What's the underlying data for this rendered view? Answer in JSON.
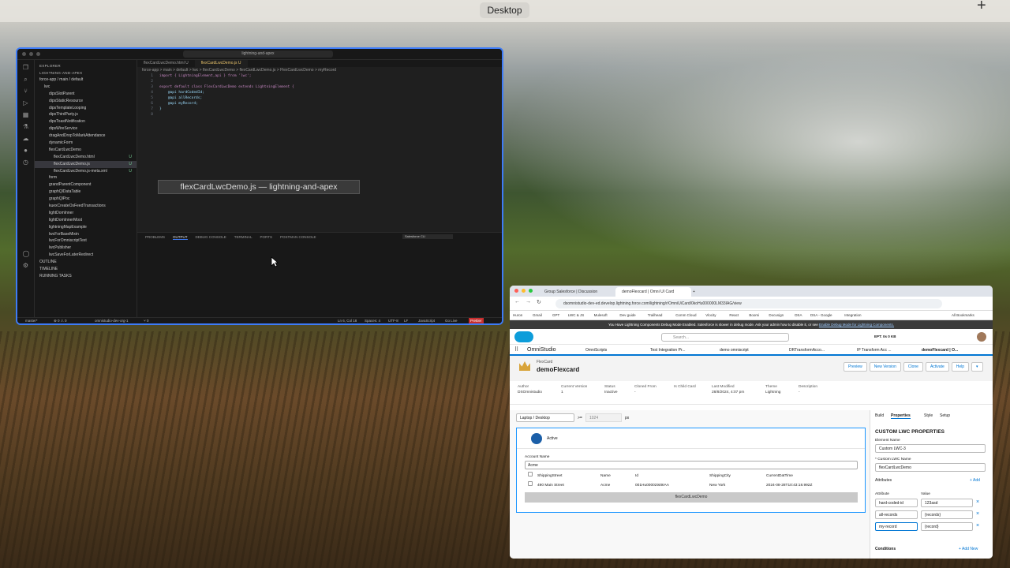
{
  "desktop": {
    "label": "Desktop"
  },
  "vscode": {
    "search": "lightning-and-apex",
    "explorer_title": "EXPLORER",
    "project": "LIGHTNING-AND-APEX",
    "tree": [
      {
        "label": "force-app / main / default",
        "indent": 0
      },
      {
        "label": "lwc",
        "indent": 1
      },
      {
        "label": "dipsSlotParent",
        "indent": 2
      },
      {
        "label": "dipsStaticResource",
        "indent": 2
      },
      {
        "label": "dipsTemplateLooping",
        "indent": 2
      },
      {
        "label": "dipsThirdParty.js",
        "indent": 2
      },
      {
        "label": "dipsToastNotification",
        "indent": 2
      },
      {
        "label": "dipsWireService",
        "indent": 2
      },
      {
        "label": "dragAndDropToMarkAttendance",
        "indent": 2
      },
      {
        "label": "dynamicForm",
        "indent": 2
      },
      {
        "label": "flexCardLwcDemo",
        "indent": 2
      },
      {
        "label": "flexCardLwcDemo.html",
        "indent": 3,
        "badge": "U"
      },
      {
        "label": "flexCardLwcDemo.js",
        "indent": 3,
        "badge": "U",
        "selected": true
      },
      {
        "label": "flexCardLwcDemo.js-meta.xml",
        "indent": 3,
        "badge": "U"
      },
      {
        "label": "form",
        "indent": 2
      },
      {
        "label": "grandParentComponent",
        "indent": 2
      },
      {
        "label": "graphQlDataTable",
        "indent": 2
      },
      {
        "label": "graphQlPoc",
        "indent": 2
      },
      {
        "label": "kuexCreateOsFeedTransactions",
        "indent": 2
      },
      {
        "label": "lightDomInner",
        "indent": 2
      },
      {
        "label": "lightDomInnerMost",
        "indent": 2
      },
      {
        "label": "lightningMapExample",
        "indent": 2
      },
      {
        "label": "lwcForBaseMixin",
        "indent": 2
      },
      {
        "label": "lwcForOmniscriptText",
        "indent": 2
      },
      {
        "label": "lwcPublisher",
        "indent": 2
      },
      {
        "label": "lwcSaveForLaterRedirect",
        "indent": 2
      },
      {
        "label": "OUTLINE",
        "indent": 0
      },
      {
        "label": "TIMELINE",
        "indent": 0
      },
      {
        "label": "RUNNING TASKS",
        "indent": 0
      }
    ],
    "tabs": [
      "flexCardLwcDemo.html U",
      "flexCardLwcDemo.js U"
    ],
    "breadcrumb": "force-app > main > default > lwc > flexCardLwcDemo > flexCardLwcDemo.js > FlexCardLwcDemo > myRecord",
    "code": [
      {
        "n": "1",
        "t": "import { LightningElement,api } from 'lwc';"
      },
      {
        "n": "2",
        "t": ""
      },
      {
        "n": "3",
        "t": "export default class FlexCardLwcDemo extends LightningElement {"
      },
      {
        "n": "4",
        "t": "    @api hardCodedId;"
      },
      {
        "n": "5",
        "t": "    @api allRecords;"
      },
      {
        "n": "6",
        "t": "    @api myRecord;"
      },
      {
        "n": "7",
        "t": "}"
      },
      {
        "n": "8",
        "t": ""
      }
    ],
    "tooltip": "flexCardLwcDemo.js — lightning-and-apex",
    "panel_tabs": [
      "PROBLEMS",
      "OUTPUT",
      "DEBUG CONSOLE",
      "TERMINAL",
      "PORTS",
      "POSTMAN CONSOLE"
    ],
    "panel_select": "Salesforce CLI",
    "status": {
      "branch": "master*",
      "sync": "⊗ 0 ⚠ 0",
      "org": "omnistudio-dev-org-1",
      "ports": "⑂ 0",
      "pos": "Ln 6, Col 18",
      "spaces": "Spaces: 4",
      "enc": "UTF-8",
      "eol": "LF",
      "lang": "JavaScript",
      "live": "Go Live",
      "prettier": "Prettier"
    }
  },
  "browser": {
    "tabs": [
      "Group Salesforce | Discussion",
      "demoFlexcard | Omni UI Card"
    ],
    "url": "dsomnistudio-dev-ed.develop.lightning.force.com/lightning/r/OmniUiCard/0koHu000000LM33IAG/view",
    "bookmarks": [
      "Huron",
      "Gmail",
      "GPT",
      "LWC & JS",
      "Mulesoft",
      "Dev guide",
      "Trailhead",
      "Comm Cloud",
      "Vlocity",
      "React",
      "Boomi",
      "Docusign",
      "DSA",
      "DSA - Google",
      "Integration",
      "All Bookmarks"
    ],
    "warning": "You Have Lightning Components Debug Mode Enabled. Salesforce is slower in debug mode. Ask your admin how to disable it, or see",
    "warning_link": "Enable Debug Mode for Lightning Components.",
    "search_placeholder": "Search...",
    "ept": "EPT: 0s 0 KB",
    "app": "OmniStudio",
    "nav": [
      "OmniScripts",
      "Test Integration Pr...",
      "demo omniscript",
      "DRTransformAcco...",
      "IP Transform Acc ...",
      "demoFlexcard | O..."
    ],
    "record_type": "FlexCard",
    "record_name": "demoFlexcard",
    "buttons": [
      "Preview",
      "New Version",
      "Clone",
      "Activate",
      "Help"
    ],
    "meta": [
      {
        "l": "Author",
        "v": "DSOmnistudio"
      },
      {
        "l": "Current Version",
        "v": "1"
      },
      {
        "l": "Status",
        "v": "Inactive"
      },
      {
        "l": "Cloned From",
        "v": "-"
      },
      {
        "l": "Is Child Card",
        "v": ""
      },
      {
        "l": "Last Modified",
        "v": "28/8/2024, 4:07 pm"
      },
      {
        "l": "Theme",
        "v": "Lightning"
      },
      {
        "l": "Description",
        "v": "-"
      }
    ],
    "viewport": "Laptop / Desktop",
    "width_op": ">=",
    "width_val": "1024",
    "width_unit": "px",
    "state": "Active",
    "account_label": "Account Name",
    "account_value": "Acme",
    "table_headers": [
      "ShippingStreet",
      "Name",
      "Id",
      "ShippingCity",
      "CurrentDatTime"
    ],
    "table_row": [
      "490 Main Street",
      "Acme",
      "001Hu00002tst9IAA",
      "New York",
      "2024-08-28T10:43:18.992Z"
    ],
    "lwc_label": "flexCardLwcDemo",
    "prop_tabs": [
      "Build",
      "Properties",
      "Style",
      "Setup"
    ],
    "prop_title": "CUSTOM LWC PROPERTIES",
    "element_name_label": "Element Name",
    "element_name": "Custom LWC-3",
    "lwc_name_label": "* Custom LWC Name",
    "lwc_name": "flexCardLwcDemo",
    "attributes_label": "Attributes",
    "add": "+ Add",
    "attr_h": "Attribute",
    "val_h": "Value",
    "attrs": [
      {
        "a": "hard-coded-id",
        "v": "123asd"
      },
      {
        "a": "all-records",
        "v": "{records}"
      },
      {
        "a": "my-record",
        "v": "{record}"
      }
    ],
    "conditions": "Conditions",
    "add_new": "+ Add New"
  }
}
